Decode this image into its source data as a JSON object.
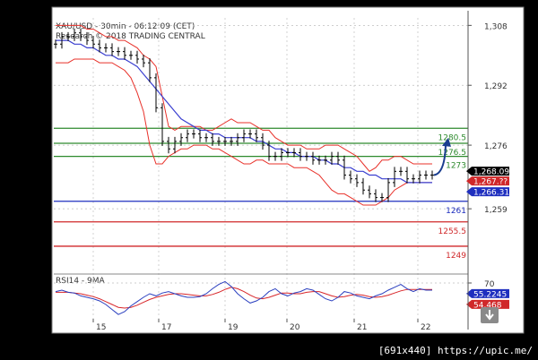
{
  "header": {
    "title": "XAU/USD - 30min - 06:12:09 (CET)",
    "subtitle": "Research © 2018 TRADING CENTRAL"
  },
  "footer": {
    "text": "[691x440] https://upic.me/"
  },
  "colors": {
    "price": "#000000",
    "bollinger": "#e8312a",
    "ma": "#3a3fd0",
    "green": "#2d8a2d",
    "blue": "#1f2fbf",
    "red": "#d0282a",
    "arrow": "#1a3d8f",
    "rsi_line": "#2a3fbf",
    "rsi_ma": "#d8262a"
  },
  "chart_data": [
    {
      "type": "line",
      "title": "XAU/USD - 30min - 06:12:09 (CET)",
      "x_categories": [
        "15",
        "17",
        "19",
        "20",
        "21",
        "22"
      ],
      "y_ticks": [
        "1,308",
        "1,292",
        "1,276",
        "1,259"
      ],
      "y_tick_values": [
        1308,
        1292,
        1276,
        1259
      ],
      "ylim": [
        1243,
        1310
      ],
      "grid": true,
      "levels": [
        {
          "label": "1280.5",
          "value": 1280.5,
          "color": "green"
        },
        {
          "label": "1276.5",
          "value": 1276.5,
          "color": "green"
        },
        {
          "label": "1273",
          "value": 1273,
          "color": "green"
        },
        {
          "label": "1261",
          "value": 1261,
          "color": "blue"
        },
        {
          "label": "1255.5",
          "value": 1255.5,
          "color": "red"
        },
        {
          "label": "1249",
          "value": 1249,
          "color": "red"
        }
      ],
      "price_series": [
        1303,
        1305,
        1305,
        1306,
        1305,
        1304,
        1303,
        1302,
        1302,
        1301,
        1301,
        1300,
        1300,
        1299,
        1298,
        1294,
        1286,
        1277,
        1275,
        1277,
        1278,
        1279,
        1279,
        1278,
        1278,
        1277,
        1277,
        1277,
        1277,
        1278,
        1279,
        1279,
        1278,
        1276,
        1273,
        1273,
        1274,
        1274,
        1274,
        1273,
        1273,
        1272,
        1272,
        1272,
        1273,
        1272,
        1268,
        1267,
        1266,
        1264,
        1263,
        1262,
        1262,
        1266,
        1269,
        1269,
        1267,
        1267,
        1268,
        1268,
        1268
      ],
      "ma_series": [
        1304,
        1304,
        1304,
        1303,
        1303,
        1302,
        1302,
        1301,
        1300,
        1300,
        1299,
        1299,
        1298,
        1297,
        1295,
        1293,
        1291,
        1289,
        1287,
        1285,
        1283,
        1282,
        1281,
        1280,
        1280,
        1279,
        1279,
        1278,
        1278,
        1278,
        1278,
        1278,
        1277,
        1277,
        1276,
        1275,
        1275,
        1274,
        1274,
        1273,
        1273,
        1273,
        1272,
        1272,
        1271,
        1271,
        1270,
        1270,
        1269,
        1269,
        1268,
        1268,
        1267,
        1267,
        1267,
        1267,
        1266,
        1266,
        1266,
        1266,
        1266
      ],
      "bb_upper": [
        1308,
        1308,
        1308,
        1308,
        1308,
        1307,
        1307,
        1306,
        1305,
        1305,
        1304,
        1304,
        1303,
        1302,
        1300,
        1299,
        1297,
        1289,
        1281,
        1280,
        1281,
        1281,
        1281,
        1281,
        1280,
        1280,
        1281,
        1282,
        1283,
        1282,
        1282,
        1282,
        1281,
        1280,
        1280,
        1278,
        1277,
        1276,
        1276,
        1276,
        1275,
        1275,
        1275,
        1276,
        1276,
        1276,
        1275,
        1274,
        1273,
        1271,
        1269,
        1270,
        1272,
        1272,
        1273,
        1273,
        1272,
        1271,
        1271,
        1271,
        1271
      ],
      "bb_lower": [
        1298,
        1298,
        1298,
        1299,
        1299,
        1299,
        1299,
        1298,
        1298,
        1298,
        1297,
        1296,
        1294,
        1290,
        1285,
        1276,
        1271,
        1271,
        1273,
        1274,
        1275,
        1275,
        1276,
        1276,
        1276,
        1275,
        1275,
        1274,
        1273,
        1272,
        1271,
        1271,
        1272,
        1272,
        1271,
        1271,
        1271,
        1271,
        1270,
        1270,
        1270,
        1269,
        1268,
        1266,
        1264,
        1263,
        1263,
        1262,
        1261,
        1260,
        1260,
        1260,
        1261,
        1262,
        1264,
        1265,
        1266,
        1266,
        1266,
        1266,
        1266
      ],
      "projection": {
        "from": 1268,
        "to": 1277
      },
      "price_tags": [
        {
          "label": "1,268.09",
          "value": 1268.09,
          "color": "#000000"
        },
        {
          "label": "1,267.??",
          "value": 1267.2,
          "color": "#d0282a"
        },
        {
          "label": "1,266.31",
          "value": 1266.31,
          "color": "#1f2fbf"
        }
      ]
    },
    {
      "type": "line",
      "title": "RSI14 - 9MA",
      "y_ticks": [
        "70"
      ],
      "y_tick_values": [
        70
      ],
      "ylim": [
        20,
        80
      ],
      "rsi_series": [
        58,
        60,
        57,
        56,
        52,
        50,
        48,
        45,
        40,
        33,
        26,
        30,
        38,
        44,
        50,
        55,
        52,
        56,
        58,
        55,
        52,
        50,
        50,
        51,
        55,
        62,
        68,
        72,
        65,
        55,
        48,
        42,
        45,
        50,
        58,
        62,
        55,
        52,
        56,
        58,
        62,
        60,
        54,
        48,
        45,
        50,
        58,
        56,
        52,
        50,
        48,
        52,
        55,
        60,
        64,
        68,
        62,
        58,
        62,
        60,
        60
      ],
      "rsi_ma_series": [
        57,
        57,
        57,
        56,
        55,
        53,
        51,
        48,
        44,
        40,
        36,
        35,
        36,
        39,
        43,
        47,
        50,
        52,
        54,
        55,
        55,
        54,
        53,
        52,
        52,
        54,
        57,
        61,
        64,
        62,
        58,
        53,
        49,
        48,
        50,
        53,
        56,
        56,
        55,
        55,
        57,
        58,
        58,
        55,
        52,
        50,
        51,
        53,
        54,
        53,
        51,
        50,
        51,
        53,
        56,
        59,
        61,
        61,
        61,
        61,
        61
      ],
      "value_tags": [
        {
          "label": "55.2245",
          "value": 55.2245,
          "color": "#1f2fbf"
        },
        {
          "label": "54.468",
          "value": 54.468,
          "color": "#d0282a"
        }
      ]
    }
  ]
}
